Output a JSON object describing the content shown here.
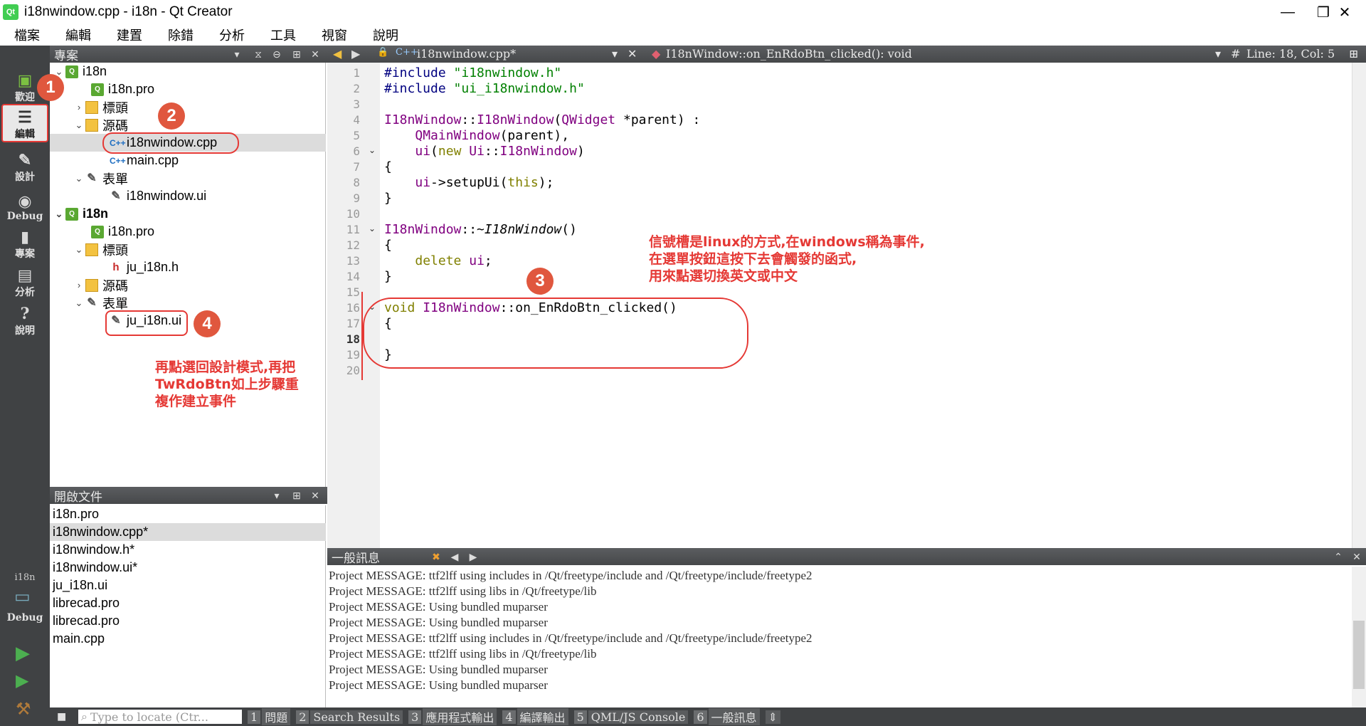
{
  "window": {
    "title": "i18nwindow.cpp - i18n - Qt Creator",
    "logo": "Qt",
    "controls": {
      "minimize": "—",
      "maximize": "❐",
      "close": "✕"
    }
  },
  "menu": [
    "檔案",
    "編輯",
    "建置",
    "除錯",
    "分析",
    "工具",
    "視窗",
    "說明"
  ],
  "modes": [
    {
      "label": "歡迎",
      "icon": "qt-welcome-icon"
    },
    {
      "label": "編輯",
      "icon": "edit-icon",
      "active": true
    },
    {
      "label": "設計",
      "icon": "design-icon"
    },
    {
      "label": "Debug",
      "icon": "debug-icon"
    },
    {
      "label": "專案",
      "icon": "project-icon"
    },
    {
      "label": "分析",
      "icon": "analyze-icon"
    },
    {
      "label": "說明",
      "icon": "help-icon"
    }
  ],
  "kit": {
    "project": "i18n",
    "config": "Debug"
  },
  "project_pane": {
    "title": "專案",
    "tree": [
      {
        "label": "i18n",
        "icon": "pro",
        "arrow": "⌄"
      },
      {
        "label": "i18n.pro",
        "icon": "pro"
      },
      {
        "label": "標頭",
        "icon": "folder",
        "arrow": "›"
      },
      {
        "label": "源碼",
        "icon": "folder",
        "arrow": "⌄"
      },
      {
        "label": "i18nwindow.cpp",
        "icon": "cpp"
      },
      {
        "label": "main.cpp",
        "icon": "cpp"
      },
      {
        "label": "表單",
        "icon": "ui",
        "arrow": "⌄"
      },
      {
        "label": "i18nwindow.ui",
        "icon": "ui"
      },
      {
        "label": "i18n",
        "icon": "pro",
        "arrow": "⌄",
        "bold": true
      },
      {
        "label": "i18n.pro",
        "icon": "pro"
      },
      {
        "label": "標頭",
        "icon": "folder",
        "arrow": "⌄"
      },
      {
        "label": "ju_i18n.h",
        "icon": "h"
      },
      {
        "label": "源碼",
        "icon": "folder",
        "arrow": "›"
      },
      {
        "label": "表單",
        "icon": "ui",
        "arrow": "⌄"
      },
      {
        "label": "ju_i18n.ui",
        "icon": "ui"
      }
    ]
  },
  "open_docs": {
    "title": "開啟文件",
    "items": [
      "i18n.pro",
      "i18nwindow.cpp*",
      "i18nwindow.h*",
      "i18nwindow.ui*",
      "ju_i18n.ui",
      "librecad.pro",
      "librecad.pro",
      "main.cpp"
    ]
  },
  "editor": {
    "file_tab": "i18nwindow.cpp*",
    "symbol": "I18nWindow::on_EnRdoBtn_clicked(): void",
    "hash": "#",
    "position": "Line: 18, Col: 5",
    "line_numbers": [
      "1",
      "2",
      "3",
      "4",
      "5",
      "6",
      "7",
      "8",
      "9",
      "10",
      "11",
      "12",
      "13",
      "14",
      "15",
      "16",
      "17",
      "18",
      "19",
      "20"
    ],
    "current_line": "18"
  },
  "output": {
    "title": "一般訊息",
    "lines": [
      "Project MESSAGE: ttf2lff using includes in /Qt/freetype/include and /Qt/freetype/include/freetype2",
      "Project MESSAGE: ttf2lff using libs in /Qt/freetype/lib",
      "Project MESSAGE: Using bundled muparser",
      "Project MESSAGE: Using bundled muparser",
      "Project MESSAGE: ttf2lff using includes in /Qt/freetype/include and /Qt/freetype/include/freetype2",
      "Project MESSAGE: ttf2lff using libs in /Qt/freetype/lib",
      "Project MESSAGE: Using bundled muparser",
      "Project MESSAGE: Using bundled muparser"
    ]
  },
  "status": {
    "locator_placeholder": "Type to locate (Ctr...",
    "tabs": [
      {
        "n": "1",
        "label": "問題"
      },
      {
        "n": "2",
        "label": "Search Results"
      },
      {
        "n": "3",
        "label": "應用程式輸出"
      },
      {
        "n": "4",
        "label": "編譯輸出"
      },
      {
        "n": "5",
        "label": "QML/JS Console"
      },
      {
        "n": "6",
        "label": "一般訊息"
      }
    ]
  },
  "annotations": {
    "badges": [
      "1",
      "2",
      "3",
      "4"
    ],
    "note_signal": [
      "信號槽是linux的方式,在windows稱為事件,",
      "在選單按鈕這按下去會觸發的函式,",
      "用來點選切換英文或中文"
    ],
    "note_design": [
      "再點選回設計模式,再把",
      "TwRdoBtn如上步驟重",
      "複作建立事件"
    ]
  }
}
